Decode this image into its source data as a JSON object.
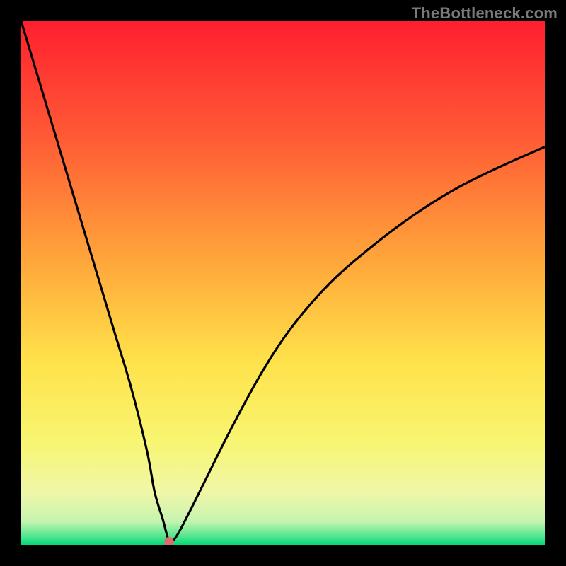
{
  "watermark": "TheBottleneck.com",
  "colors": {
    "frame_bg": "#000000",
    "curve_stroke": "#000000",
    "dot_fill": "#d96d6d",
    "gradient_stops": [
      {
        "offset": 0.0,
        "color": "#ff1f2f"
      },
      {
        "offset": 0.22,
        "color": "#ff5a35"
      },
      {
        "offset": 0.45,
        "color": "#ffa43a"
      },
      {
        "offset": 0.65,
        "color": "#ffe24a"
      },
      {
        "offset": 0.8,
        "color": "#f8f570"
      },
      {
        "offset": 0.9,
        "color": "#f0f7a8"
      },
      {
        "offset": 0.955,
        "color": "#c7f4b0"
      },
      {
        "offset": 0.985,
        "color": "#4de58c"
      },
      {
        "offset": 1.0,
        "color": "#00d877"
      }
    ]
  },
  "chart_data": {
    "type": "line",
    "title": "",
    "xlabel": "",
    "ylabel": "",
    "xlim": [
      0,
      100
    ],
    "ylim": [
      0,
      100
    ],
    "annotations": [],
    "series": [
      {
        "name": "curve",
        "x": [
          0,
          3,
          6,
          9,
          12,
          15,
          18,
          21,
          24,
          25.5,
          27,
          27.8,
          28.3,
          29,
          30,
          32,
          35,
          40,
          46,
          52,
          59,
          67,
          75,
          83,
          91,
          100
        ],
        "values": [
          100,
          90,
          80,
          70,
          60,
          50,
          40,
          30,
          18,
          10,
          5,
          2,
          0.5,
          0.8,
          2.2,
          6,
          12,
          22,
          33,
          42,
          50,
          57,
          63,
          68,
          72,
          76
        ]
      }
    ],
    "marker": {
      "x": 28.3,
      "y": 0.5,
      "color": "#d96d6d"
    }
  }
}
